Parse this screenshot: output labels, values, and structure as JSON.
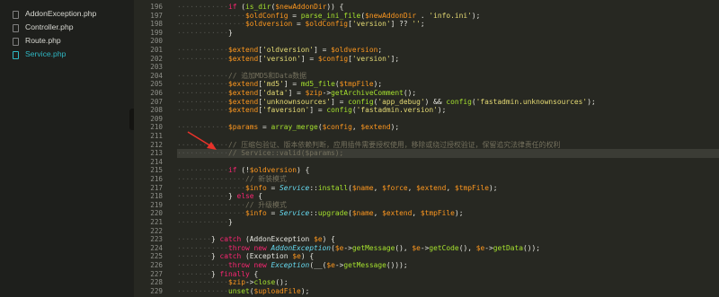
{
  "sidebar": {
    "files": [
      {
        "label": "AddonException.php",
        "icon": "file-icon",
        "active": false
      },
      {
        "label": "Controller.php",
        "icon": "file-icon",
        "active": false
      },
      {
        "label": "Route.php",
        "icon": "file-icon",
        "active": false
      },
      {
        "label": "Service.php",
        "icon": "file-icon",
        "active": true
      }
    ],
    "collapse_glyph": "‹"
  },
  "editor": {
    "line_numbers": [
      "196",
      "197",
      "198",
      "199",
      "200",
      "201",
      "202",
      "203",
      "204",
      "205",
      "206",
      "207",
      "208",
      "209",
      "210",
      "211",
      "212",
      "213",
      "214",
      "215",
      "216",
      "217",
      "218",
      "219",
      "220",
      "221",
      "222",
      "223",
      "224",
      "225",
      "226",
      "227",
      "228",
      "229"
    ],
    "highlighted_line": "213",
    "lines": [
      [
        [
          "ws",
          "············"
        ],
        [
          "kw",
          "if"
        ],
        [
          "pl",
          " ("
        ],
        [
          "fn",
          "is_dir"
        ],
        [
          "pl",
          "("
        ],
        [
          "var",
          "$newAddonDir"
        ],
        [
          "pl",
          ")) {"
        ]
      ],
      [
        [
          "ws",
          "················"
        ],
        [
          "var",
          "$oldConfig"
        ],
        [
          "pl",
          " = "
        ],
        [
          "fn",
          "parse_ini_file"
        ],
        [
          "pl",
          "("
        ],
        [
          "var",
          "$newAddonDir"
        ],
        [
          "pl",
          " . "
        ],
        [
          "str",
          "'info.ini'"
        ],
        [
          "pl",
          ");"
        ]
      ],
      [
        [
          "ws",
          "················"
        ],
        [
          "var",
          "$oldversion"
        ],
        [
          "pl",
          " = "
        ],
        [
          "var",
          "$oldConfig"
        ],
        [
          "pl",
          "["
        ],
        [
          "str",
          "'version'"
        ],
        [
          "pl",
          "] ?? "
        ],
        [
          "str",
          "''"
        ],
        [
          "pl",
          ";"
        ]
      ],
      [
        [
          "ws",
          "············"
        ],
        [
          "pl",
          "}"
        ]
      ],
      [],
      [
        [
          "ws",
          "············"
        ],
        [
          "var",
          "$extend"
        ],
        [
          "pl",
          "["
        ],
        [
          "str",
          "'oldversion'"
        ],
        [
          "pl",
          "] = "
        ],
        [
          "var",
          "$oldversion"
        ],
        [
          "pl",
          ";"
        ]
      ],
      [
        [
          "ws",
          "············"
        ],
        [
          "var",
          "$extend"
        ],
        [
          "pl",
          "["
        ],
        [
          "str",
          "'version'"
        ],
        [
          "pl",
          "] = "
        ],
        [
          "var",
          "$config"
        ],
        [
          "pl",
          "["
        ],
        [
          "str",
          "'version'"
        ],
        [
          "pl",
          "];"
        ]
      ],
      [],
      [
        [
          "ws",
          "············"
        ],
        [
          "cm",
          "// 追加MD5和Data数据"
        ]
      ],
      [
        [
          "ws",
          "············"
        ],
        [
          "var",
          "$extend"
        ],
        [
          "pl",
          "["
        ],
        [
          "str",
          "'md5'"
        ],
        [
          "pl",
          "] = "
        ],
        [
          "fn",
          "md5_file"
        ],
        [
          "pl",
          "("
        ],
        [
          "var",
          "$tmpFile"
        ],
        [
          "pl",
          ");"
        ]
      ],
      [
        [
          "ws",
          "············"
        ],
        [
          "var",
          "$extend"
        ],
        [
          "pl",
          "["
        ],
        [
          "str",
          "'data'"
        ],
        [
          "pl",
          "] = "
        ],
        [
          "var",
          "$zip"
        ],
        [
          "pl",
          "->"
        ],
        [
          "fn",
          "getArchiveComment"
        ],
        [
          "pl",
          "();"
        ]
      ],
      [
        [
          "ws",
          "············"
        ],
        [
          "var",
          "$extend"
        ],
        [
          "pl",
          "["
        ],
        [
          "str",
          "'unknownsources'"
        ],
        [
          "pl",
          "] = "
        ],
        [
          "fn",
          "config"
        ],
        [
          "pl",
          "("
        ],
        [
          "str",
          "'app_debug'"
        ],
        [
          "pl",
          ") && "
        ],
        [
          "fn",
          "config"
        ],
        [
          "pl",
          "("
        ],
        [
          "str",
          "'fastadmin.unknownsources'"
        ],
        [
          "pl",
          ");"
        ]
      ],
      [
        [
          "ws",
          "············"
        ],
        [
          "var",
          "$extend"
        ],
        [
          "pl",
          "["
        ],
        [
          "str",
          "'faversion'"
        ],
        [
          "pl",
          "] = "
        ],
        [
          "fn",
          "config"
        ],
        [
          "pl",
          "("
        ],
        [
          "str",
          "'fastadmin.version'"
        ],
        [
          "pl",
          ");"
        ]
      ],
      [],
      [
        [
          "ws",
          "············"
        ],
        [
          "var",
          "$params"
        ],
        [
          "pl",
          " = "
        ],
        [
          "fn",
          "array_merge"
        ],
        [
          "pl",
          "("
        ],
        [
          "var",
          "$config"
        ],
        [
          "pl",
          ", "
        ],
        [
          "var",
          "$extend"
        ],
        [
          "pl",
          ");"
        ]
      ],
      [],
      [
        [
          "ws",
          "············"
        ],
        [
          "cm",
          "// 压缩包验证、版本依赖判断，应用插件需要授权使用，移除或绕过授权验证，保留追究法律责任的权利"
        ]
      ],
      [
        [
          "ws",
          "············"
        ],
        [
          "cm",
          "// Service::valid($params);"
        ]
      ],
      [],
      [
        [
          "ws",
          "············"
        ],
        [
          "kw",
          "if"
        ],
        [
          "pl",
          " (!"
        ],
        [
          "var",
          "$oldversion"
        ],
        [
          "pl",
          ") {"
        ]
      ],
      [
        [
          "ws",
          "················"
        ],
        [
          "cm",
          "// 新装模式"
        ]
      ],
      [
        [
          "ws",
          "················"
        ],
        [
          "var",
          "$info"
        ],
        [
          "pl",
          " = "
        ],
        [
          "cls",
          "Service"
        ],
        [
          "pl",
          "::"
        ],
        [
          "fn",
          "install"
        ],
        [
          "pl",
          "("
        ],
        [
          "var",
          "$name"
        ],
        [
          "pl",
          ", "
        ],
        [
          "var",
          "$force"
        ],
        [
          "pl",
          ", "
        ],
        [
          "var",
          "$extend"
        ],
        [
          "pl",
          ", "
        ],
        [
          "var",
          "$tmpFile"
        ],
        [
          "pl",
          ");"
        ]
      ],
      [
        [
          "ws",
          "············"
        ],
        [
          "pl",
          "} "
        ],
        [
          "kw",
          "else"
        ],
        [
          "pl",
          " {"
        ]
      ],
      [
        [
          "ws",
          "················"
        ],
        [
          "cm",
          "// 升级模式"
        ]
      ],
      [
        [
          "ws",
          "················"
        ],
        [
          "var",
          "$info"
        ],
        [
          "pl",
          " = "
        ],
        [
          "cls",
          "Service"
        ],
        [
          "pl",
          "::"
        ],
        [
          "fn",
          "upgrade"
        ],
        [
          "pl",
          "("
        ],
        [
          "var",
          "$name"
        ],
        [
          "pl",
          ", "
        ],
        [
          "var",
          "$extend"
        ],
        [
          "pl",
          ", "
        ],
        [
          "var",
          "$tmpFile"
        ],
        [
          "pl",
          ");"
        ]
      ],
      [
        [
          "ws",
          "············"
        ],
        [
          "pl",
          "}"
        ]
      ],
      [],
      [
        [
          "ws",
          "········"
        ],
        [
          "pl",
          "} "
        ],
        [
          "kw",
          "catch"
        ],
        [
          "pl",
          " (AddonException "
        ],
        [
          "var",
          "$e"
        ],
        [
          "pl",
          ") {"
        ]
      ],
      [
        [
          "ws",
          "············"
        ],
        [
          "kw",
          "throw new"
        ],
        [
          "pl",
          " "
        ],
        [
          "cls",
          "AddonException"
        ],
        [
          "pl",
          "("
        ],
        [
          "var",
          "$e"
        ],
        [
          "pl",
          "->"
        ],
        [
          "fn",
          "getMessage"
        ],
        [
          "pl",
          "(), "
        ],
        [
          "var",
          "$e"
        ],
        [
          "pl",
          "->"
        ],
        [
          "fn",
          "getCode"
        ],
        [
          "pl",
          "(), "
        ],
        [
          "var",
          "$e"
        ],
        [
          "pl",
          "->"
        ],
        [
          "fn",
          "getData"
        ],
        [
          "pl",
          "());"
        ]
      ],
      [
        [
          "ws",
          "········"
        ],
        [
          "pl",
          "} "
        ],
        [
          "kw",
          "catch"
        ],
        [
          "pl",
          " (Exception "
        ],
        [
          "var",
          "$e"
        ],
        [
          "pl",
          ") {"
        ]
      ],
      [
        [
          "ws",
          "············"
        ],
        [
          "kw",
          "throw new"
        ],
        [
          "pl",
          " "
        ],
        [
          "cls",
          "Exception"
        ],
        [
          "pl",
          "(__("
        ],
        [
          "var",
          "$e"
        ],
        [
          "pl",
          "->"
        ],
        [
          "fn",
          "getMessage"
        ],
        [
          "pl",
          "()));"
        ]
      ],
      [
        [
          "ws",
          "········"
        ],
        [
          "pl",
          "} "
        ],
        [
          "kw",
          "finally"
        ],
        [
          "pl",
          " {"
        ]
      ],
      [
        [
          "ws",
          "············"
        ],
        [
          "var",
          "$zip"
        ],
        [
          "pl",
          "->"
        ],
        [
          "fn",
          "close"
        ],
        [
          "pl",
          "();"
        ]
      ],
      [
        [
          "ws",
          "············"
        ],
        [
          "fn",
          "unset"
        ],
        [
          "pl",
          "("
        ],
        [
          "var",
          "$uploadFile"
        ],
        [
          "pl",
          ");"
        ]
      ]
    ]
  },
  "colors": {
    "background": "#272822",
    "sidebar_bg": "#1e1f1c",
    "keyword": "#f92672",
    "variable": "#fd971f",
    "function": "#a6e22e",
    "string": "#e6db74",
    "class": "#66d9ef",
    "comment": "#75715e",
    "annotation_arrow": "#e8322a"
  }
}
